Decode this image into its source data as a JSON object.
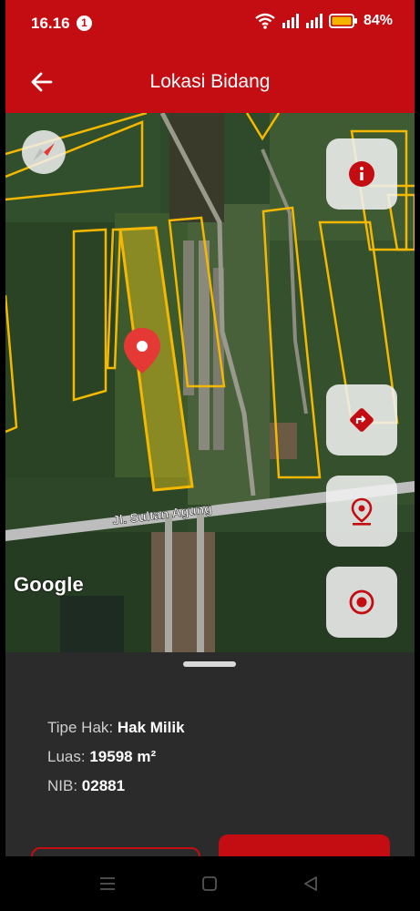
{
  "status_bar": {
    "time": "16.16",
    "notification_count": "1",
    "battery_percent": "84%",
    "icons": [
      "wifi-icon",
      "signal-icon",
      "signal-icon",
      "battery-icon"
    ]
  },
  "app_bar": {
    "title": "Lokasi Bidang",
    "back_icon": "arrow-left-icon"
  },
  "map": {
    "road_label": "Jl. Sultan Agung",
    "attribution": "Google",
    "marker_icon": "location-pin-icon",
    "compass_icon": "compass-icon",
    "buttons": [
      {
        "name": "info-button",
        "icon": "info-icon"
      },
      {
        "name": "directions-button",
        "icon": "directions-icon"
      },
      {
        "name": "marker-button",
        "icon": "map-pin-icon"
      },
      {
        "name": "my-location-button",
        "icon": "target-icon"
      }
    ],
    "colors": {
      "parcel_outline": "#f5b800",
      "selected_fill": "#c9b21e",
      "road": "#bdbdbd"
    }
  },
  "details": {
    "tipe_hak_label": "Tipe Hak:",
    "tipe_hak_value": "Hak Milik",
    "luas_label": "Luas:",
    "luas_value": "19598 m²",
    "nib_label": "NIB:",
    "nib_value": "02881"
  },
  "colors": {
    "brand": "#c40d12",
    "sheet": "#2b2b2b"
  }
}
